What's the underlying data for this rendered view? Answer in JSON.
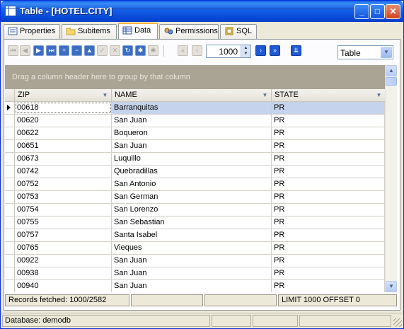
{
  "window": {
    "title": "Table - [HOTEL.CITY]",
    "minimize_glyph": "_",
    "maximize_glyph": "□",
    "close_glyph": "✕"
  },
  "tabs": [
    {
      "label": "Properties",
      "icon": "properties-icon"
    },
    {
      "label": "Subitems",
      "icon": "folder-icon"
    },
    {
      "label": "Data",
      "icon": "table-icon",
      "active": true
    },
    {
      "label": "Permissions",
      "icon": "permissions-icon"
    },
    {
      "label": "SQL",
      "icon": "sql-icon"
    }
  ],
  "navigator": {
    "first": "⏮",
    "prior": "◀",
    "next": "▶",
    "last": "⏭",
    "insert": "+",
    "delete": "−",
    "edit": "▲",
    "post": "✓",
    "cancel": "✕",
    "refresh": "↻",
    "apply": "✱",
    "cancel_updates": "✱",
    "first_page": "«",
    "prev_page": "‹",
    "page_size": "1000",
    "next_page": "›",
    "last_page": "»",
    "fetch_all": "⇊"
  },
  "view_mode": {
    "selected": "Table"
  },
  "grid": {
    "group_hint": "Drag a column header here to group by that column",
    "columns": [
      "ZIP",
      "NAME",
      "STATE"
    ],
    "rows": [
      {
        "zip": "00618",
        "name": "Barranquitas",
        "state": "PR"
      },
      {
        "zip": "00620",
        "name": "San Juan",
        "state": "PR"
      },
      {
        "zip": "00622",
        "name": "Boqueron",
        "state": "PR"
      },
      {
        "zip": "00651",
        "name": "San Juan",
        "state": "PR"
      },
      {
        "zip": "00673",
        "name": "Luquillo",
        "state": "PR"
      },
      {
        "zip": "00742",
        "name": "Quebradillas",
        "state": "PR"
      },
      {
        "zip": "00752",
        "name": "San Antonio",
        "state": "PR"
      },
      {
        "zip": "00753",
        "name": "San German",
        "state": "PR"
      },
      {
        "zip": "00754",
        "name": "San Lorenzo",
        "state": "PR"
      },
      {
        "zip": "00755",
        "name": "San Sebastian",
        "state": "PR"
      },
      {
        "zip": "00757",
        "name": "Santa Isabel",
        "state": "PR"
      },
      {
        "zip": "00765",
        "name": "Vieques",
        "state": "PR"
      },
      {
        "zip": "00922",
        "name": "San Juan",
        "state": "PR"
      },
      {
        "zip": "00938",
        "name": "San Juan",
        "state": "PR"
      },
      {
        "zip": "00940",
        "name": "San Juan",
        "state": "PR"
      }
    ]
  },
  "info": {
    "records_fetched": "Records fetched: 1000/2582",
    "limit_offset": "LIMIT 1000 OFFSET 0"
  },
  "status": {
    "database": "Database: demodb"
  },
  "colors": {
    "titlebar": "#0A5FEA",
    "selected_row": "#C6D3EC",
    "group_panel": "#A9A493"
  }
}
